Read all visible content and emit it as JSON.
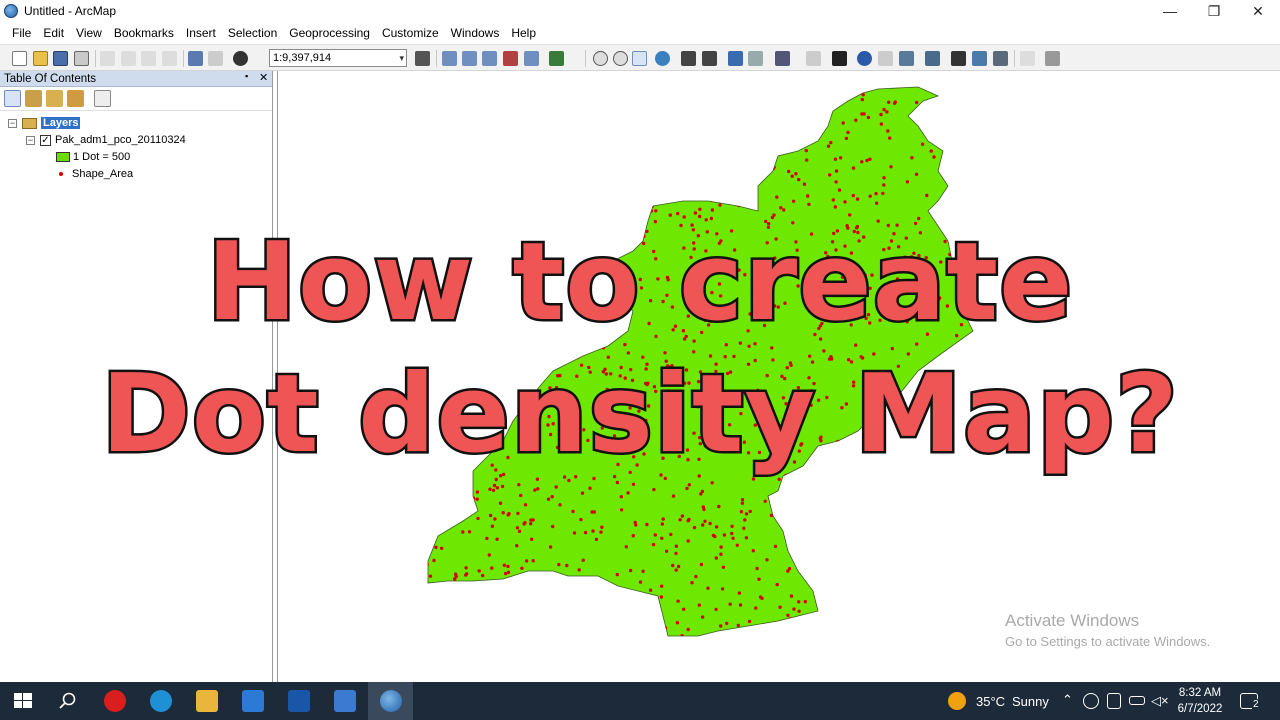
{
  "window": {
    "title": "Untitled - ArcMap",
    "minimize_glyph": "—",
    "restore_glyph": "❐",
    "close_glyph": "✕"
  },
  "menu": [
    "File",
    "Edit",
    "View",
    "Bookmarks",
    "Insert",
    "Selection",
    "Geoprocessing",
    "Customize",
    "Windows",
    "Help"
  ],
  "toolbar": {
    "scale_value": "1:9,397,914",
    "dropdown_glyph": "▾"
  },
  "toc": {
    "title": "Table Of Contents",
    "pin_glyph": "📌",
    "close_glyph": "✕",
    "root_label": "Layers",
    "layer_name": "Pak_adm1_pco_20110324",
    "legend_dot_value": "1 Dot = 500",
    "field_name": "Shape_Area",
    "collapse_glyph": "−",
    "check_glyph": "✓"
  },
  "overlay": {
    "line1": "How to create",
    "line2": "Dot density Map?"
  },
  "watermark": {
    "line1": "Activate Windows",
    "line2": "Go to Settings to activate Windows."
  },
  "taskbar": {
    "weather_temp": "35°C",
    "weather_text": "Sunny",
    "time": "8:32 AM",
    "date": "6/7/2022",
    "notification_count": "2"
  },
  "colors": {
    "map_fill": "#6EE800",
    "dot": "#D40000",
    "overlay_text": "#F05555",
    "taskbar": "#1C2A3A"
  }
}
